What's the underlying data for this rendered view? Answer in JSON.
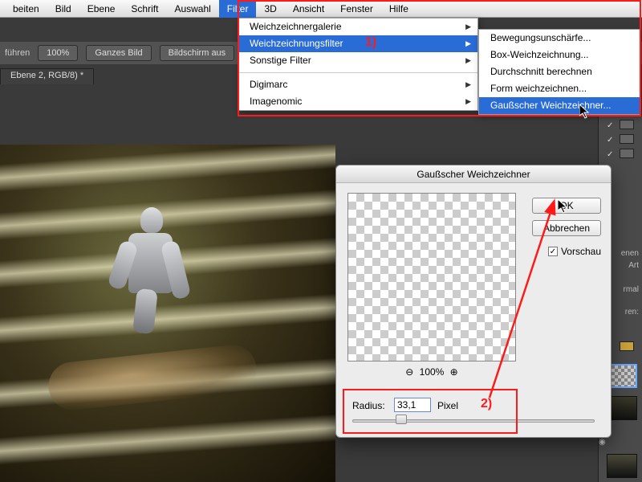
{
  "menubar": {
    "items": [
      "beiten",
      "Bild",
      "Ebene",
      "Schrift",
      "Auswahl",
      "Filter",
      "3D",
      "Ansicht",
      "Fenster",
      "Hilfe"
    ],
    "selected_index": 5
  },
  "optbar": {
    "label0": "führen",
    "btn0": "100%",
    "btn1": "Ganzes Bild",
    "btn2": "Bildschirm aus"
  },
  "doctab": "Ebene 2, RGB/8) *",
  "filter_menu": {
    "items": [
      {
        "label": "Weichzeichnergalerie",
        "sub": true,
        "sel": false
      },
      {
        "label": "Weichzeichnungsfilter",
        "sub": true,
        "sel": true
      },
      {
        "label": "Sonstige Filter",
        "sub": true,
        "sel": false
      },
      {
        "sep": true
      },
      {
        "label": "Digimarc",
        "sub": true,
        "sel": false
      },
      {
        "label": "Imagenomic",
        "sub": true,
        "sel": false
      }
    ]
  },
  "blur_submenu": {
    "items": [
      {
        "label": "Bewegungsunschärfe...",
        "sel": false
      },
      {
        "label": "Box-Weichzeichnung...",
        "sel": false
      },
      {
        "label": "Durchschnitt berechnen",
        "sel": false
      },
      {
        "label": "Form weichzeichnen...",
        "sel": false
      },
      {
        "label": "Gaußscher Weichzeichner...",
        "sel": true
      }
    ]
  },
  "dialog": {
    "title": "Gaußscher Weichzeichner",
    "ok": "OK",
    "cancel": "Abbrechen",
    "preview_label": "Vorschau",
    "preview_checked": "✓",
    "zoom_minus": "⊖",
    "zoom_pct": "100%",
    "zoom_plus": "⊕",
    "radius_label": "Radius:",
    "radius_value": "33,1",
    "radius_unit": "Pixel"
  },
  "annotations": {
    "one": "1)",
    "two": "2)"
  },
  "rpanel": {
    "tab1": "enen",
    "tab2": "Art",
    "mode": "rmal",
    "lock": "ren:",
    "check": "✓"
  }
}
